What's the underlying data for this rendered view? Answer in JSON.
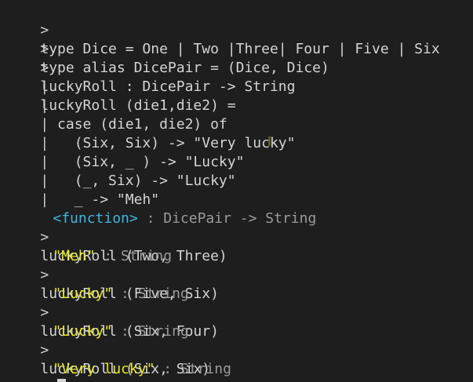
{
  "terminal": {
    "prompt_symbol": ">",
    "continuation_symbol": "|",
    "input_lines": [
      "type Dice = One | Two |Three| Four | Five | Six",
      "type alias DicePair = (Dice, Dice)",
      "luckyRoll : DicePair -> String",
      "luckyRoll (die1,die2) =",
      "  case (die1, die2) of",
      "    (Six, Six) -> \"Very lucky\"",
      "    (Six, _ ) -> \"Lucky\"",
      "    (_, Six) -> \"Lucky\"",
      "    _ -> \"Meh\"",
      ""
    ],
    "function_result": {
      "tag": "<function>",
      "type": " : DicePair -> String"
    },
    "calls": [
      {
        "input": "luckyRoll (Two, Three)",
        "value": "\"Meh\"",
        "type": " : String"
      },
      {
        "input": "luckyRoll (Five, Six)",
        "value": "\"Lucky\"",
        "type": " : String"
      },
      {
        "input": "luckyRoll (Six, Four)",
        "value": "\"Lucky\"",
        "type": " : String"
      },
      {
        "input": "luckyRoll (Six, Six)",
        "value": "\"Very lucky\"",
        "type": " : String"
      }
    ]
  },
  "colors": {
    "background": "#1e1e1e",
    "text": "#d4d4d4",
    "function_tag": "#3fb5e0",
    "string_value": "#e8e82a",
    "type_annotation": "#9a9a9a"
  }
}
